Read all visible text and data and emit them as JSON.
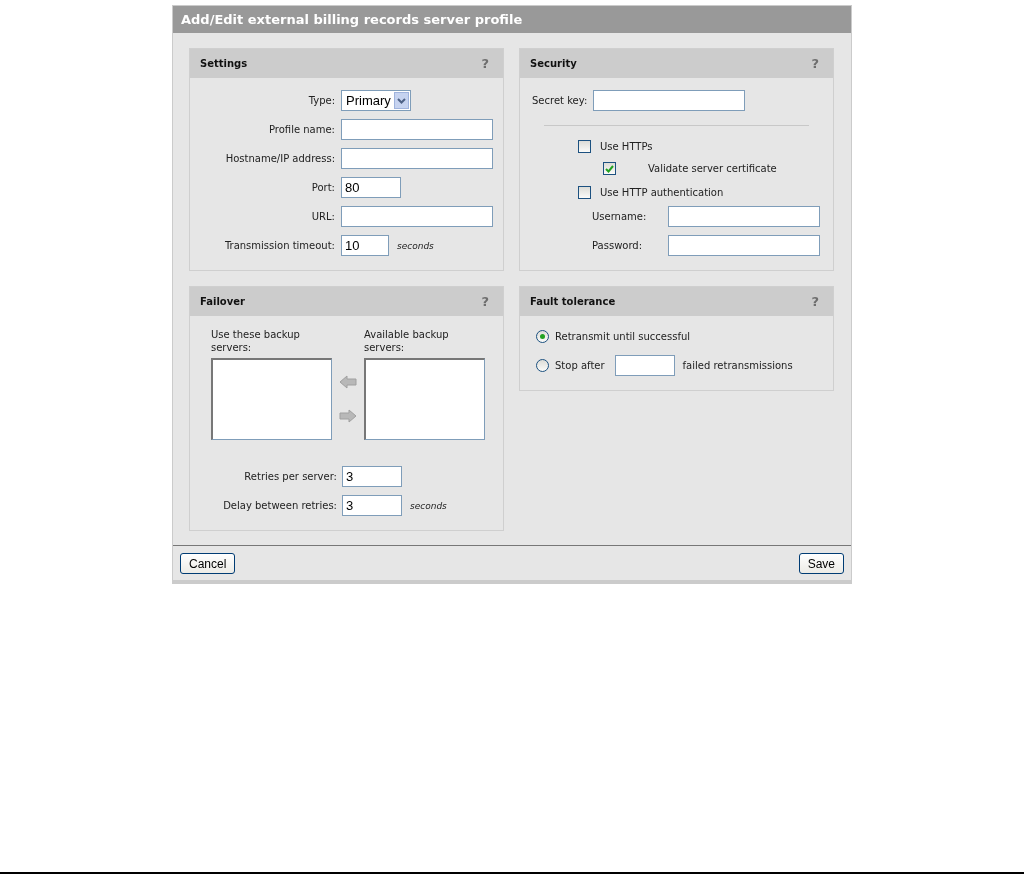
{
  "dialog": {
    "title": "Add/Edit external billing records server profile"
  },
  "settings": {
    "title": "Settings",
    "help": "?",
    "fields": [
      {
        "kind": "select",
        "label": "Type:",
        "value": "Primary"
      },
      {
        "kind": "text",
        "label": "Profile name:"
      },
      {
        "kind": "text",
        "label": "Hostname/IP address:"
      },
      {
        "kind": "short",
        "label": "Port:",
        "value": "80"
      },
      {
        "kind": "text",
        "label": "URL:"
      },
      {
        "kind": "tiny",
        "label": "Transmission timeout:",
        "value": "10",
        "unit": "seconds"
      }
    ]
  },
  "security": {
    "title": "Security",
    "help": "?",
    "secret_key": {
      "label": "Secret key:"
    },
    "options": [
      {
        "label": "Use HTTPs",
        "checked": false,
        "children": [
          {
            "label": "Validate server certificate",
            "checked": true
          }
        ]
      },
      {
        "label": "Use HTTP authentication",
        "checked": false
      }
    ],
    "fields": [
      {
        "label": "Username:"
      },
      {
        "label": "Password:"
      }
    ]
  },
  "failover": {
    "title": "Failover",
    "help": "?",
    "selected_list": {
      "label": "Use these backup servers:"
    },
    "available_list": {
      "label": "Available backup servers:"
    },
    "fields": [
      {
        "label": "Retries per server:",
        "value": "3"
      },
      {
        "label": "Delay between retries:",
        "value": "3",
        "unit": "seconds"
      }
    ]
  },
  "fault_tolerance": {
    "title": "Fault tolerance",
    "help": "?",
    "options": [
      {
        "kind": "plain",
        "label": "Retransmit until successful",
        "selected": true
      },
      {
        "kind": "count",
        "label": "Stop after",
        "suffix": "failed retransmissions",
        "selected": false
      }
    ]
  },
  "buttons": {
    "cancel": "Cancel",
    "save": "Save"
  }
}
